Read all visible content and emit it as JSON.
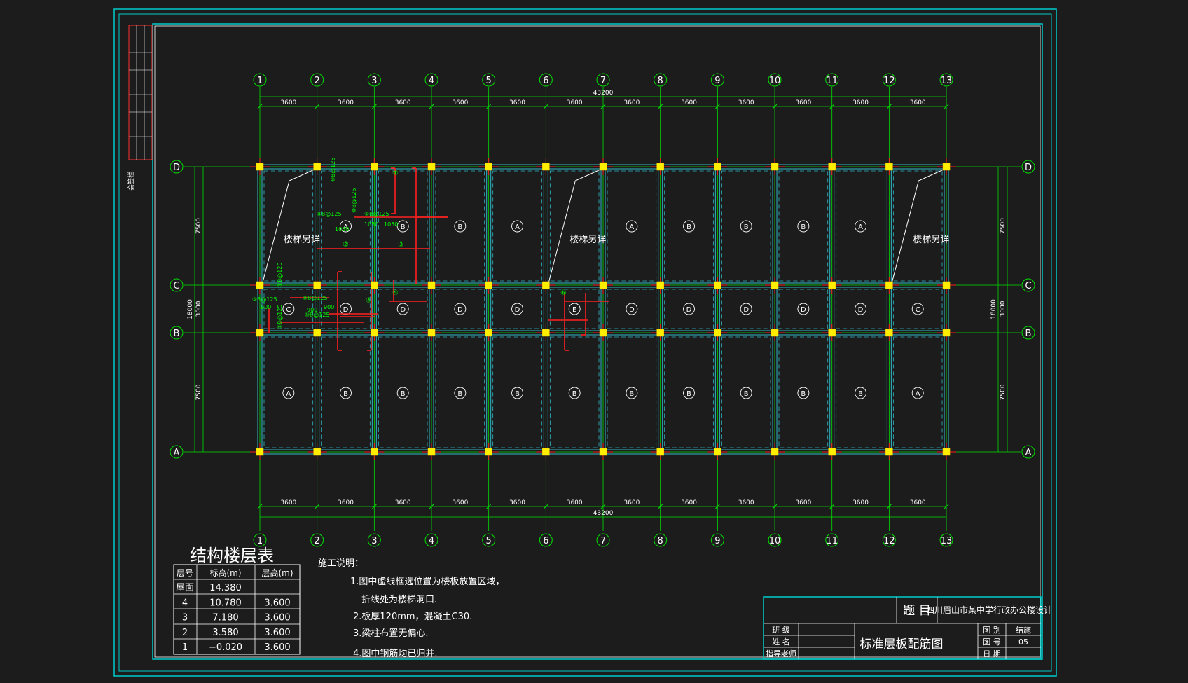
{
  "colors": {
    "background": "#1c1c1c",
    "frame": "#00cccc",
    "axis": "#00e000",
    "column": "#ffee00",
    "beam": "#2fb8c8",
    "slab_text": "#ffffff",
    "rebar": "#ff2020",
    "rebar_text": "#00ff00"
  },
  "grid": {
    "x_labels": [
      "1",
      "2",
      "3",
      "4",
      "5",
      "6",
      "7",
      "8",
      "9",
      "10",
      "11",
      "12",
      "13"
    ],
    "y_labels": [
      "D",
      "C",
      "B",
      "A"
    ],
    "span_labels": [
      "3600",
      "3600",
      "3600",
      "3600",
      "3600",
      "3600",
      "3600",
      "3600",
      "3600",
      "3600",
      "3600",
      "3600"
    ],
    "total_width": "43200",
    "left_dims": [
      "7500",
      "3000",
      "7500"
    ],
    "left_total": "18000",
    "right_dims": [
      "7500",
      "3000",
      "7500"
    ],
    "right_total": "18000"
  },
  "slabs": {
    "top_row": [
      "",
      "A",
      "B",
      "B",
      "A",
      "",
      "A",
      "B",
      "B",
      "B",
      "A",
      ""
    ],
    "middle_row": [
      "C",
      "D",
      "D",
      "D",
      "D",
      "E",
      "D",
      "D",
      "D",
      "D",
      "D",
      "C"
    ],
    "bottom_row": [
      "A",
      "B",
      "B",
      "B",
      "B",
      "B",
      "B",
      "B",
      "B",
      "B",
      "B",
      "A"
    ]
  },
  "stair_notes": [
    "楼梯另详",
    "楼梯另详",
    "楼梯另详"
  ],
  "rebar_labels": [
    "⑩8@125",
    "⑧8@125",
    "⑧8@125",
    "⑥8@125",
    "⑦8@125",
    "⑥8@125",
    "⑧8@125",
    "⑨8@125",
    "⑩8@125",
    "1050",
    "1050",
    "1050",
    "900",
    "900",
    "900"
  ],
  "rebar_marks": [
    "①",
    "②",
    "③",
    "④",
    "⑤",
    "⑥"
  ],
  "side_label": "会签栏",
  "floor_table": {
    "title": "结构楼层表",
    "headers": [
      "层号",
      "标高(m)",
      "层高(m)"
    ],
    "rows": [
      [
        "屋面",
        "14.380",
        ""
      ],
      [
        "4",
        "10.780",
        "3.600"
      ],
      [
        "3",
        "7.180",
        "3.600"
      ],
      [
        "2",
        "3.580",
        "3.600"
      ],
      [
        "1",
        "−0.020",
        "3.600"
      ]
    ]
  },
  "notes": {
    "heading": "施工说明：",
    "lines": [
      "1.图中虚线框选位置为楼板放置区域，",
      "折线处为楼梯洞口.",
      "2.板厚120mm，混凝土C30.",
      "3.梁柱布置无偏心.",
      "4.图中钢筋均已归并."
    ]
  },
  "title_block": {
    "project_label": "题  目",
    "project_name": "四川眉山市某中学行政办公楼设计",
    "class_label": "班  级",
    "name_label": "姓  名",
    "advisor_label": "指导老师",
    "drawing_title": "标准层板配筋图",
    "type_label": "图  别",
    "type_value": "结施",
    "number_label": "图  号",
    "number_value": "05",
    "date_label": "日  期",
    "date_value": ""
  }
}
